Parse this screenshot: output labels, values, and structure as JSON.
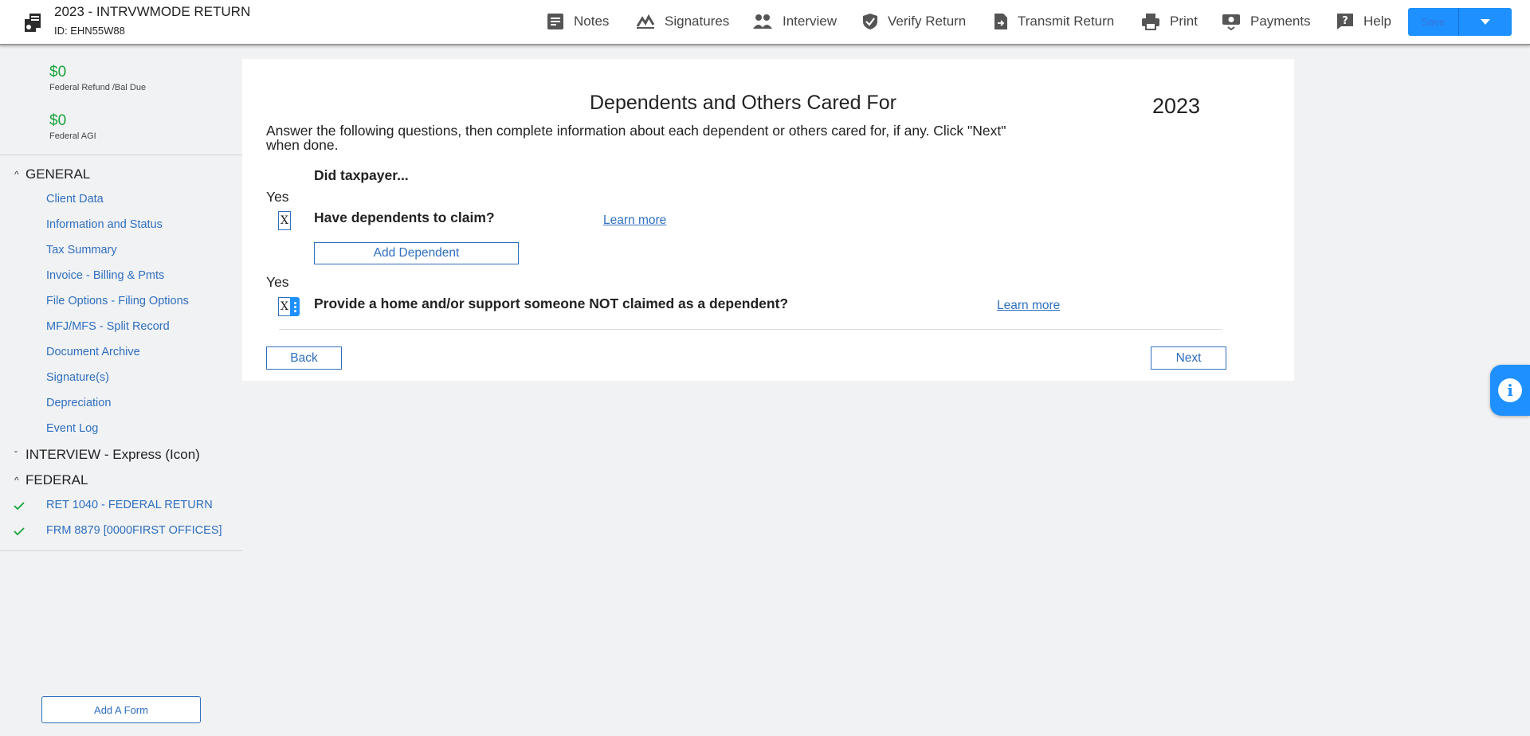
{
  "header": {
    "return_title": "2023 - INTRVWMODE RETURN",
    "return_id": "ID: EHN55W88",
    "nav": [
      {
        "label": "Notes",
        "icon": "notes-icon"
      },
      {
        "label": "Signatures",
        "icon": "signature-icon"
      },
      {
        "label": "Interview",
        "icon": "interview-icon"
      },
      {
        "label": "Verify Return",
        "icon": "shield-check-icon"
      },
      {
        "label": "Transmit Return",
        "icon": "transmit-icon"
      },
      {
        "label": "Print",
        "icon": "printer-icon"
      },
      {
        "label": "Payments",
        "icon": "payments-icon"
      },
      {
        "label": "Help",
        "icon": "help-icon"
      }
    ],
    "save_label": "Save"
  },
  "sidebar": {
    "refund_amount": "$0",
    "refund_caption": "Federal Refund /Bal Due",
    "agi_amount": "$0",
    "agi_caption": "Federal AGI",
    "general": {
      "label": "GENERAL",
      "items": [
        "Client Data",
        "Information and Status",
        "Tax Summary",
        "Invoice - Billing & Pmts",
        "File Options - Filing Options",
        "MFJ/MFS - Split Record",
        "Document Archive",
        "Signature(s)",
        "Depreciation",
        "Event Log"
      ]
    },
    "interview": {
      "label": "INTERVIEW - Express (Icon)"
    },
    "federal": {
      "label": "FEDERAL",
      "items": [
        "RET 1040 - FEDERAL RETURN",
        "FRM 8879 [0000FIRST OFFICES]"
      ]
    },
    "add_form_label": "Add A Form"
  },
  "main": {
    "title": "Dependents and Others Cared For",
    "year": "2023",
    "instructions": "Answer the following questions, then complete information about each dependent or others cared for, if any. Click \"Next\" when done.",
    "intro": "Did taxpayer...",
    "questions": [
      {
        "yes_label": "Yes",
        "value": "X",
        "text": "Have dependents to claim?",
        "learn_more": "Learn more"
      },
      {
        "yes_label": "Yes",
        "value": "X",
        "text": "Provide a home and/or support someone NOT claimed as a dependent?",
        "learn_more": "Learn more"
      }
    ],
    "add_dependent_label": "Add Dependent",
    "back_label": "Back",
    "next_label": "Next"
  },
  "colors": {
    "accent": "#1e90ff",
    "link": "#2f6fbf",
    "money": "#18a33a"
  }
}
